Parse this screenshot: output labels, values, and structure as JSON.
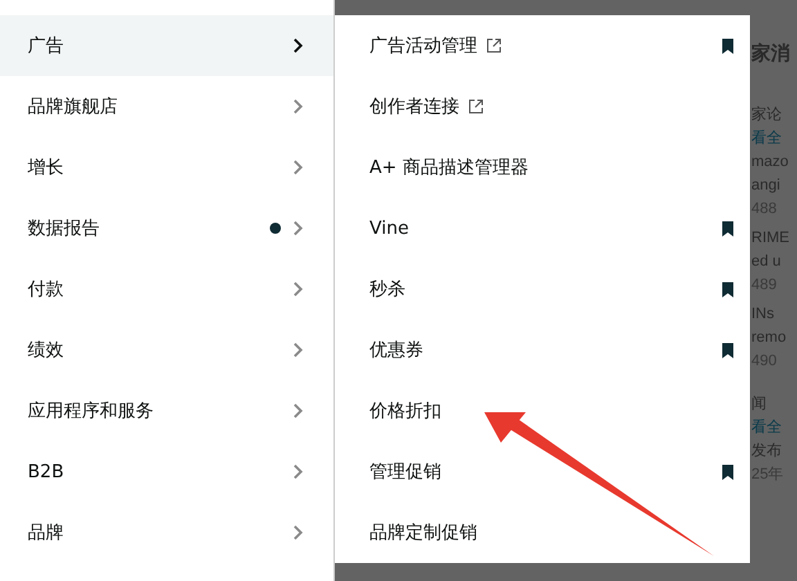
{
  "main_menu": [
    {
      "label": "广告",
      "selected": true,
      "dot": false
    },
    {
      "label": "品牌旗舰店",
      "selected": false,
      "dot": false
    },
    {
      "label": "增长",
      "selected": false,
      "dot": false
    },
    {
      "label": "数据报告",
      "selected": false,
      "dot": true
    },
    {
      "label": "付款",
      "selected": false,
      "dot": false
    },
    {
      "label": "绩效",
      "selected": false,
      "dot": false
    },
    {
      "label": "应用程序和服务",
      "selected": false,
      "dot": false
    },
    {
      "label": "B2B",
      "selected": false,
      "dot": false
    },
    {
      "label": "品牌",
      "selected": false,
      "dot": false
    }
  ],
  "submenu": [
    {
      "label": "广告活动管理",
      "external": true,
      "bookmarked": true
    },
    {
      "label": "创作者连接",
      "external": true,
      "bookmarked": false
    },
    {
      "label": "A+ 商品描述管理器",
      "external": false,
      "bookmarked": false
    },
    {
      "label": "Vine",
      "external": false,
      "bookmarked": true
    },
    {
      "label": "秒杀",
      "external": false,
      "bookmarked": true
    },
    {
      "label": "优惠券",
      "external": false,
      "bookmarked": true
    },
    {
      "label": "价格折扣",
      "external": false,
      "bookmarked": false
    },
    {
      "label": "管理促销",
      "external": false,
      "bookmarked": true
    },
    {
      "label": "品牌定制促销",
      "external": false,
      "bookmarked": false
    }
  ],
  "background_page": [
    {
      "text": "家消",
      "kind": "heading"
    },
    {
      "text": "家论",
      "kind": "title"
    },
    {
      "text": "看全",
      "kind": "link"
    },
    {
      "text": "mazo",
      "kind": "text"
    },
    {
      "text": "angi",
      "kind": "text"
    },
    {
      "text": "488",
      "kind": "date"
    },
    {
      "text": "RIME",
      "kind": "text"
    },
    {
      "text": "ed u",
      "kind": "text"
    },
    {
      "text": "489",
      "kind": "date"
    },
    {
      "text": "INs",
      "kind": "text"
    },
    {
      "text": "remo",
      "kind": "text"
    },
    {
      "text": "490",
      "kind": "date"
    },
    {
      "text": "闻",
      "kind": "title"
    },
    {
      "text": "看全",
      "kind": "link"
    },
    {
      "text": "发布",
      "kind": "text"
    },
    {
      "text": "25年",
      "kind": "date"
    }
  ]
}
